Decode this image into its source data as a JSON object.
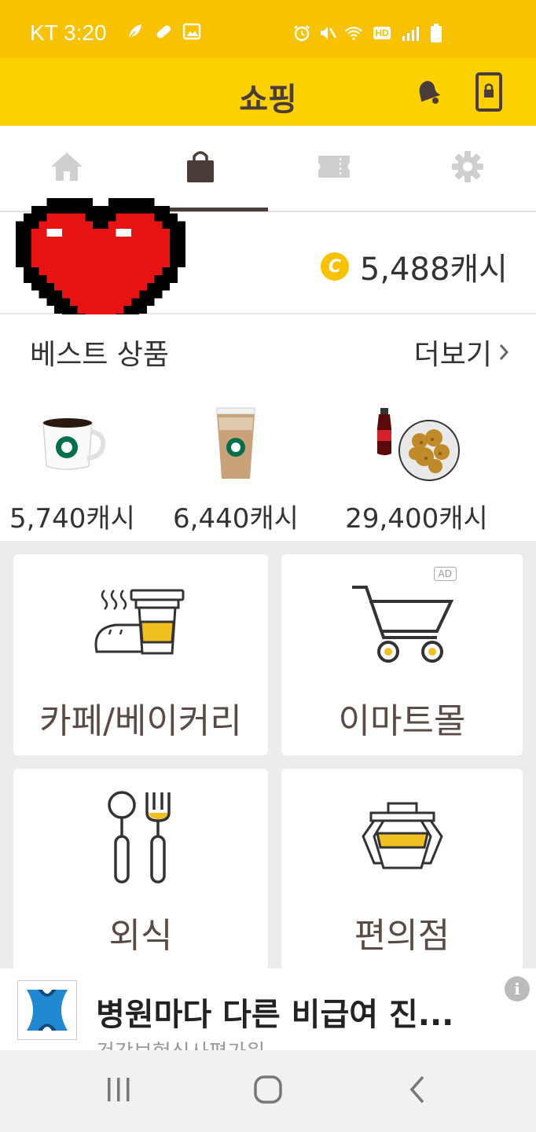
{
  "status_bar": {
    "time": "KT 3:20",
    "left_icons": [
      "leaf-icon",
      "pill-icon",
      "image-icon"
    ],
    "right_icons": [
      "alarm-icon",
      "mute-icon",
      "wifi-icon",
      "hd-icon",
      "signal-icon",
      "battery-icon"
    ],
    "hd_text": "HD",
    "bg_color": "#f8c200"
  },
  "header": {
    "title": "쇼핑",
    "bg_color": "#fdd100"
  },
  "tabs": [
    {
      "icon": "home-icon",
      "selected": false
    },
    {
      "icon": "shopping-bag-icon",
      "selected": true
    },
    {
      "icon": "ticket-icon",
      "selected": false
    },
    {
      "icon": "gear-icon",
      "selected": false
    }
  ],
  "profile": {
    "coin_symbol": "C",
    "cash": "5,488캐시"
  },
  "best_products": {
    "title": "베스트 상품",
    "more_label": "더보기",
    "items": [
      {
        "image": "coffee-mug",
        "price": "5,740캐시"
      },
      {
        "image": "iced-latte",
        "price": "6,440캐시"
      },
      {
        "image": "chicken-and-cola",
        "price": "29,400캐시"
      }
    ]
  },
  "categories": [
    {
      "label": "카페/베이커리",
      "icon": "cafe-bakery-icon",
      "ad": false
    },
    {
      "label": "이마트몰",
      "icon": "cart-icon",
      "ad": true,
      "ad_label": "AD"
    },
    {
      "label": "외식",
      "icon": "spoon-fork-icon",
      "ad": false
    },
    {
      "label": "편의점",
      "icon": "convenience-store-icon",
      "ad": false
    }
  ],
  "ad_banner": {
    "title": "병원마다 다른 비급여 진...",
    "subtitle": "건강보험심사평가원",
    "info": "i"
  },
  "accent_color": "#f5c518"
}
